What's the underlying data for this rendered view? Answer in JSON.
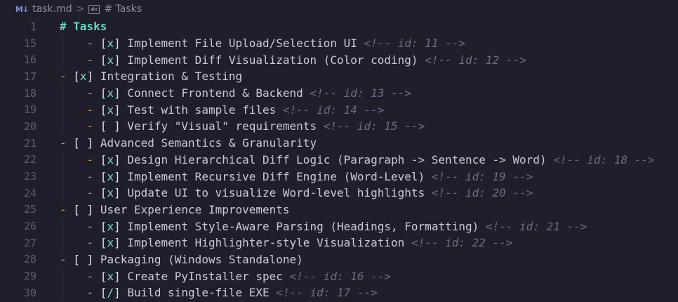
{
  "breadcrumb": {
    "file_icon": "markdown-icon",
    "file_icon_text": "M↓",
    "file": "task.md",
    "separator": ">",
    "symbol_icon": "string-symbol-icon",
    "symbol_icon_text": "abc",
    "symbol": "# Tasks"
  },
  "colors": {
    "background": "#1e1f2b",
    "heading": "#67d6c8",
    "dash": "#ce9a62",
    "check": "#7fdccd",
    "comment": "#6a6d86",
    "line_number": "#5b5e73"
  },
  "lines": [
    {
      "num": "1",
      "heading": "# Tasks"
    },
    {
      "num": "15",
      "indent": "    ",
      "dash": "- ",
      "box": "[x]",
      "text": " Implement File Upload/Selection UI ",
      "comment": "<!-- id: 11 -->"
    },
    {
      "num": "16",
      "indent": "    ",
      "dash": "- ",
      "box": "[x]",
      "text": " Implement Diff Visualization (Color coding) ",
      "comment": "<!-- id: 12 -->"
    },
    {
      "num": "17",
      "indent": "",
      "dash": "- ",
      "box": "[x]",
      "text": " Integration & Testing",
      "comment": ""
    },
    {
      "num": "18",
      "indent": "    ",
      "dash": "- ",
      "box": "[x]",
      "text": " Connect Frontend & Backend ",
      "comment": "<!-- id: 13 -->"
    },
    {
      "num": "19",
      "indent": "    ",
      "dash": "- ",
      "box": "[x]",
      "text": " Test with sample files ",
      "comment": "<!-- id: 14 -->"
    },
    {
      "num": "20",
      "indent": "    ",
      "dash": "- ",
      "box": "[ ]",
      "text": " Verify \"Visual\" requirements ",
      "comment": "<!-- id: 15 -->"
    },
    {
      "num": "21",
      "indent": "",
      "dash": "- ",
      "box": "[ ]",
      "text": " Advanced Semantics & Granularity",
      "comment": ""
    },
    {
      "num": "22",
      "indent": "    ",
      "dash": "- ",
      "box": "[x]",
      "text": " Design Hierarchical Diff Logic (Paragraph -> Sentence -> Word) ",
      "comment": "<!-- id: 18 -->"
    },
    {
      "num": "23",
      "indent": "    ",
      "dash": "- ",
      "box": "[x]",
      "text": " Implement Recursive Diff Engine (Word-Level) ",
      "comment": "<!-- id: 19 -->"
    },
    {
      "num": "24",
      "indent": "    ",
      "dash": "- ",
      "box": "[x]",
      "text": " Update UI to visualize Word-level highlights ",
      "comment": "<!-- id: 20 -->"
    },
    {
      "num": "25",
      "indent": "",
      "dash": "- ",
      "box": "[ ]",
      "text": " User Experience Improvements",
      "comment": ""
    },
    {
      "num": "26",
      "indent": "    ",
      "dash": "- ",
      "box": "[x]",
      "text": " Implement Style-Aware Parsing (Headings, Formatting) ",
      "comment": "<!-- id: 21 -->"
    },
    {
      "num": "27",
      "indent": "    ",
      "dash": "- ",
      "box": "[x]",
      "text": " Implement Highlighter-style Visualization ",
      "comment": "<!-- id: 22 -->"
    },
    {
      "num": "28",
      "indent": "",
      "dash": "- ",
      "box": "[ ]",
      "text": " Packaging (Windows Standalone)",
      "comment": ""
    },
    {
      "num": "29",
      "indent": "    ",
      "dash": "- ",
      "box": "[x]",
      "text": " Create PyInstaller spec ",
      "comment": "<!-- id: 16 -->"
    },
    {
      "num": "30",
      "indent": "    ",
      "dash": "- ",
      "box": "[/]",
      "text": " Build single-file EXE ",
      "comment": "<!-- id: 17 -->"
    }
  ]
}
